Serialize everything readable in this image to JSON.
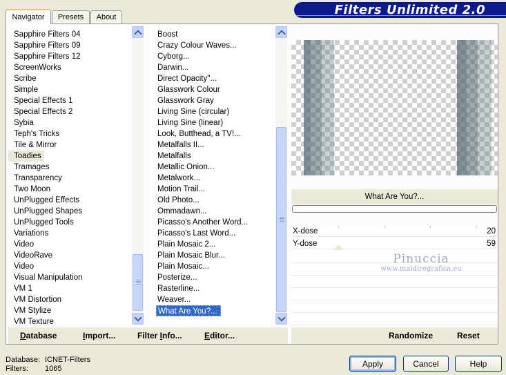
{
  "tabs": [
    {
      "label": "Navigator"
    },
    {
      "label": "Presets"
    },
    {
      "label": "About"
    }
  ],
  "app_title": "Filters Unlimited 2.0",
  "categories": {
    "items": [
      "Sapphire Filters 04",
      "Sapphire Filters 09",
      "Sapphire Filters 12",
      "ScreenWorks",
      "Scribe",
      "Simple",
      "Special Effects 1",
      "Special Effects 2",
      "Sybia",
      "Teph's Tricks",
      "Tile & Mirror",
      "Toadies",
      "Tramages",
      "Transparency",
      "Two Moon",
      "UnPlugged Effects",
      "UnPlugged Shapes",
      "UnPlugged Tools",
      "Variations",
      "Video",
      "VideoRave",
      "Video",
      "Visual Manipulation",
      "VM 1",
      "VM Distortion",
      "VM Stylize",
      "VM Texture"
    ],
    "selected": "Toadies"
  },
  "filters": {
    "items": [
      "Boost",
      "Crazy Colour Waves...",
      "Cyborg...",
      "Darwin...",
      "Direct Opacity''...",
      "Glasswork Colour",
      "Glasswork Gray",
      "Living Sine (circular)",
      "Living Sine (linear)",
      "Look, Butthead, a TV!...",
      "Metalfalls II...",
      "Metalfalls",
      "Metallic Onion...",
      "Metalwork...",
      "Motion Trail...",
      "Old Photo...",
      "Ommadawn...",
      "Picasso's Another Word...",
      "Picasso's Last Word...",
      "Plain Mosaic 2...",
      "Plain Mosaic Blur...",
      "Plain Mosaic...",
      "Posterize...",
      "Rasterline...",
      "Weaver...",
      "What Are You?..."
    ],
    "selected": "What Are You?..."
  },
  "current_filter": "What Are You?...",
  "params": [
    {
      "label": "X-dose",
      "value": "20"
    },
    {
      "label": "Y-dose",
      "value": "59"
    }
  ],
  "watermark": {
    "name": "Pinuccia",
    "url": "www.maidiregrafica.eu"
  },
  "toolbar": {
    "database": {
      "accel": "D",
      "rest": "atabase"
    },
    "import": {
      "accel": "I",
      "rest": "mport..."
    },
    "filter_info": {
      "pre": "Filter ",
      "accel": "I",
      "rest": "nfo..."
    },
    "editor": {
      "accel": "E",
      "rest": "ditor..."
    },
    "randomize": "Randomize",
    "reset": "Reset"
  },
  "status": {
    "database_label": "Database:",
    "database_value": "ICNET-Filters",
    "filters_label": "Filters:",
    "filters_value": "1065"
  },
  "buttons": {
    "apply": "Apply",
    "cancel": "Cancel",
    "help": "Help"
  }
}
